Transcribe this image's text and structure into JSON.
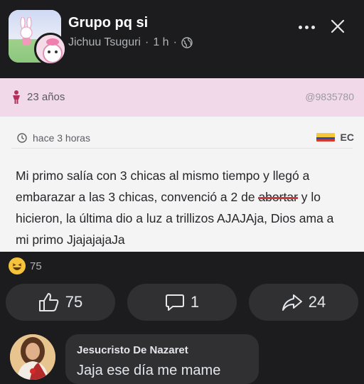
{
  "header": {
    "group_name": "Grupo pq si",
    "author": "Jichuu Tsuguri",
    "separator": "·",
    "time_ago": "1 h",
    "privacy_icon": "globe-icon",
    "more_icon": "more-dots-icon",
    "close_icon": "close-icon"
  },
  "card": {
    "age": "23 años",
    "code": "@9835780",
    "posted": "hace 3 horas",
    "country": "EC",
    "text_part1": "Mi primo salía con 3 chicas al mismo tiempo y llegó a embarazar a las 3 chicas, convenció a 2 de ",
    "text_redacted": "abortar",
    "text_part2": " y lo hicieron, la última dio a luz a trillizos AJAJAja, Dios ama a mi primo JjajajajaJa"
  },
  "reactions": {
    "emoji": "haha-emoji",
    "count": "75"
  },
  "actions": {
    "like_count": "75",
    "comment_count": "1",
    "share_count": "24"
  },
  "comment": {
    "author": "Jesucristo De Nazaret",
    "text": "Jaja ese día me mame"
  },
  "colors": {
    "background": "#1c1c1e",
    "card_background": "#f4f4f5",
    "card_header": "#f1d9ea",
    "button_background": "#303033",
    "redaction_line": "#d13b3b"
  }
}
